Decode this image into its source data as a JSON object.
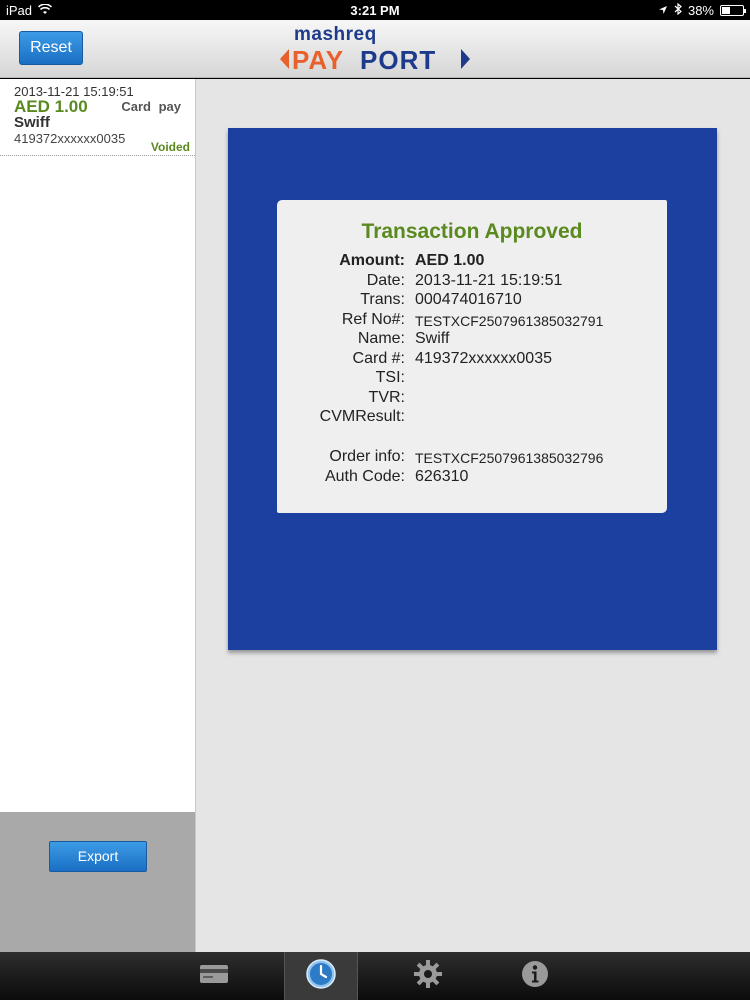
{
  "status_bar": {
    "device": "iPad",
    "time": "3:21 PM",
    "battery": "38%",
    "battery_level": 0.38
  },
  "header": {
    "reset_label": "Reset",
    "logo_top": "mashreq",
    "logo_main": "PAYPORT",
    "brand_colors": {
      "blue": "#1e3a8a",
      "orange": "#e8602c"
    }
  },
  "transactions": [
    {
      "date": "2013-11-21 15:19:51",
      "amount": "AED 1.00",
      "type": "Card pay",
      "name": "Swiff",
      "card": "419372xxxxxx0035",
      "status": "Voided"
    }
  ],
  "footer": {
    "export_label": "Export"
  },
  "receipt": {
    "title": "Transaction Approved",
    "amount_label": "Amount:",
    "amount": "AED 1.00",
    "date_label": "Date:",
    "date": "2013-11-21 15:19:51",
    "trans_label": "Trans:",
    "trans": "000474016710",
    "ref_label": "Ref No#:",
    "ref": "TESTXCF2507961385032791",
    "name_label": "Name:",
    "name": "Swiff",
    "card_label": "Card #:",
    "card": "419372xxxxxx0035",
    "tsi_label": "TSI:",
    "tsi": "",
    "tvr_label": "TVR:",
    "tvr": "",
    "cvm_label": "CVMResult:",
    "cvm": "",
    "order_label": "Order info:",
    "order": "TESTXCF2507961385032796",
    "auth_label": "Auth Code:",
    "auth": "626310"
  },
  "tab_bar": {
    "tabs": [
      {
        "icon": "card-icon"
      },
      {
        "icon": "clock-icon",
        "active": true
      },
      {
        "icon": "gear-icon"
      },
      {
        "icon": "info-icon"
      }
    ]
  },
  "colors": {
    "accent_green": "#5a8a1f",
    "panel_blue": "#1c40a0",
    "button_blue": "#1a6fc4"
  }
}
